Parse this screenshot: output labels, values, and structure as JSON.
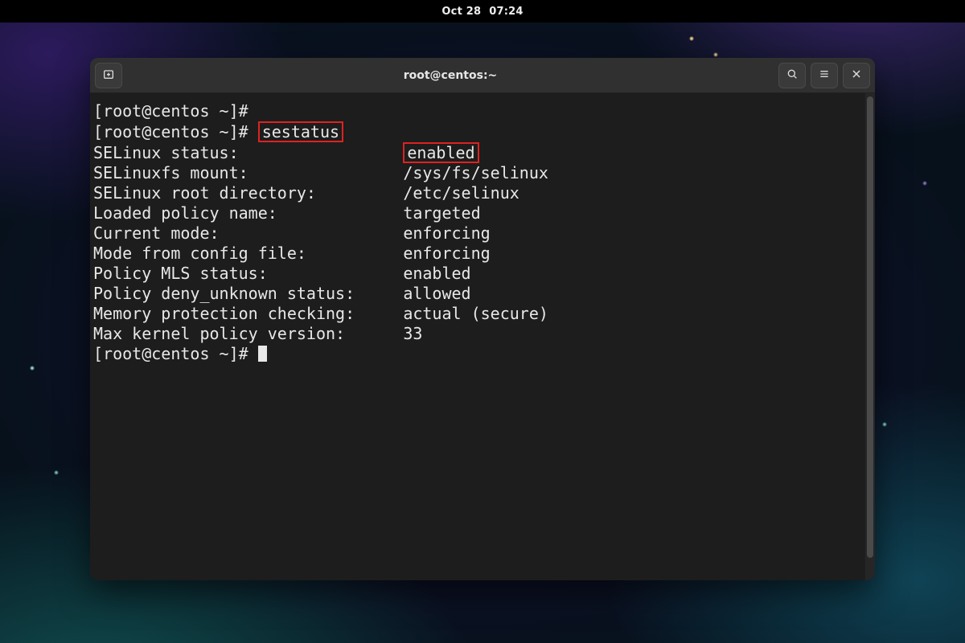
{
  "topbar": {
    "date": "Oct 28",
    "time": "07:24"
  },
  "window": {
    "title": "root@centos:~",
    "icons": {
      "new_tab": "new-tab-icon",
      "search": "search-icon",
      "menu": "hamburger-icon",
      "close": "close-icon"
    }
  },
  "terminal": {
    "prompt": "[root@centos ~]# ",
    "command": "sestatus",
    "highlight_command": true,
    "highlight_value_row_index": 0,
    "rows": [
      {
        "label": "SELinux status:",
        "value": "enabled"
      },
      {
        "label": "SELinuxfs mount:",
        "value": "/sys/fs/selinux"
      },
      {
        "label": "SELinux root directory:",
        "value": "/etc/selinux"
      },
      {
        "label": "Loaded policy name:",
        "value": "targeted"
      },
      {
        "label": "Current mode:",
        "value": "enforcing"
      },
      {
        "label": "Mode from config file:",
        "value": "enforcing"
      },
      {
        "label": "Policy MLS status:",
        "value": "enabled"
      },
      {
        "label": "Policy deny_unknown status:",
        "value": "allowed"
      },
      {
        "label": "Memory protection checking:",
        "value": "actual (secure)"
      },
      {
        "label": "Max kernel policy version:",
        "value": "33"
      }
    ],
    "label_col_width": 32
  }
}
